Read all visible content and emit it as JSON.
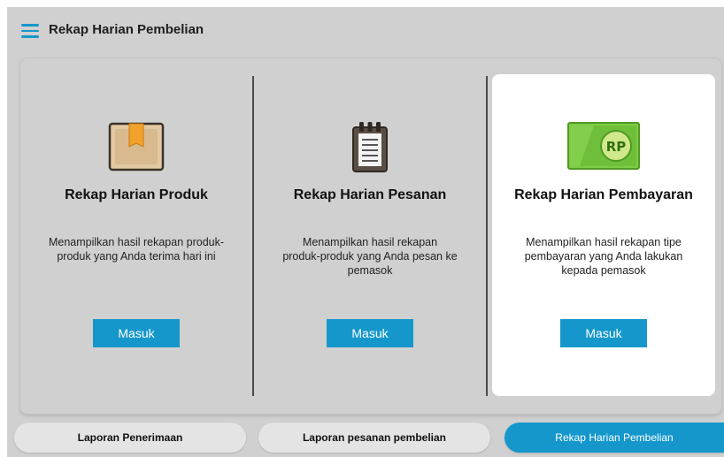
{
  "header": {
    "title": "Rekap Harian Pembelian",
    "menu_icon": "hamburger-menu-icon"
  },
  "cards": [
    {
      "icon": "box-icon",
      "title": "Rekap Harian Produk",
      "description": "Menampilkan hasil rekapan produk-produk yang Anda terima hari ini",
      "button_label": "Masuk",
      "active": false
    },
    {
      "icon": "notepad-icon",
      "title": "Rekap Harian Pesanan",
      "description": "Menampilkan hasil rekapan produk-produk yang Anda pesan ke pemasok",
      "button_label": "Masuk",
      "active": false
    },
    {
      "icon": "money-rp-icon",
      "icon_text": "RP",
      "title": "Rekap Harian Pembayaran",
      "description": "Menampilkan hasil rekapan tipe pembayaran yang Anda lakukan kepada pemasok",
      "button_label": "Masuk",
      "active": true
    }
  ],
  "tabs": [
    {
      "label": "Laporan Penerimaan",
      "active": false
    },
    {
      "label": "Laporan pesanan pembelian",
      "active": false
    },
    {
      "label": "Rekap Harian Pembelian",
      "active": true
    }
  ],
  "colors": {
    "accent": "#1597cc",
    "background": "#d0d0d0",
    "active_card": "#ffffff",
    "money_green": "#6fbf3a"
  }
}
